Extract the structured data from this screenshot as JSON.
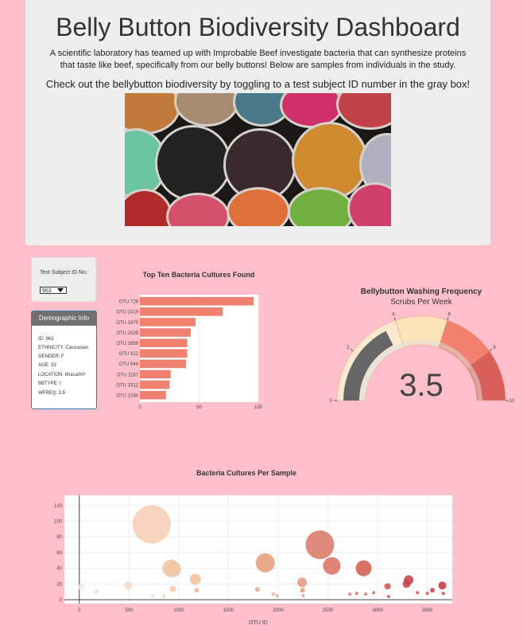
{
  "header": {
    "title": "Belly Button Biodiversity Dashboard",
    "intro": "A scientific laboratory has teamed up with Improbable Beef investigate bacteria that can synthesize proteins that taste like beef, specifically from our belly buttons! Below are samples from individuals in the study.",
    "cta": "Check out the bellybutton biodiversity by toggling to a test subject ID number in the gray box!"
  },
  "selector": {
    "label": "Test Subject ID No.:",
    "value": "963"
  },
  "demographics": {
    "heading": "Demographic Info",
    "rows": [
      "ID: 963",
      "ETHNICITY: Caucasian",
      "GENDER: F",
      "AGE: 33",
      "LOCATION: Ithaca/NY",
      "BBTYPE: I",
      "WFREQ: 3.5"
    ]
  },
  "colors": {
    "bar": "#f0806f",
    "background": "#ffc0cb",
    "gauge_needle": "#666666"
  },
  "chart_data": [
    {
      "type": "bar",
      "orientation": "horizontal",
      "title": "Top Ten Bacteria Cultures Found",
      "categories": [
        "OTU 728",
        "OTU 2419",
        "OTU 1870",
        "OTU 2539",
        "OTU 2859",
        "OTU 922",
        "OTU 944",
        "OTU 1167",
        "OTU 3312",
        "OTU 2244"
      ],
      "values": [
        96,
        70,
        47,
        43,
        40,
        40,
        39,
        26,
        25,
        22
      ],
      "xlim": [
        0,
        100
      ],
      "xticks": [
        "0",
        "50",
        "100"
      ]
    },
    {
      "type": "gauge",
      "title": "Bellybutton Washing Frequency",
      "subtitle": "Scrubs Per Week",
      "value": 3.5,
      "value_label": "3.5",
      "range": [
        0,
        10
      ],
      "ticks": [
        "0",
        "2",
        "4",
        "6",
        "8",
        "10"
      ],
      "bands": [
        {
          "from": 0,
          "to": 4,
          "color": "#fbe9cf"
        },
        {
          "from": 4,
          "to": 6,
          "color": "#fde4b8"
        },
        {
          "from": 6,
          "to": 8,
          "color": "#f2806f"
        },
        {
          "from": 8,
          "to": 10,
          "color": "#d9605a"
        }
      ]
    },
    {
      "type": "scatter",
      "title": "Bacteria Cultures Per Sample",
      "xlabel": "OTU ID",
      "xlim": [
        -150,
        3750
      ],
      "ylim": [
        -5,
        133
      ],
      "xticks": [
        0,
        500,
        1000,
        1500,
        2000,
        2500,
        3000,
        3500
      ],
      "yticks": [
        0,
        20,
        40,
        60,
        80,
        100,
        120
      ],
      "points": [
        {
          "x": 20,
          "y": 16,
          "size": 4,
          "color": "#f0e8e4"
        },
        {
          "x": 170,
          "y": 10,
          "size": 3,
          "color": "#f1e4dc"
        },
        {
          "x": 490,
          "y": 18,
          "size": 5,
          "color": "#f3dcc8"
        },
        {
          "x": 728,
          "y": 96,
          "size": 24,
          "color": "#f5cdb2"
        },
        {
          "x": 740,
          "y": 5,
          "size": 2,
          "color": "#f4d8c4"
        },
        {
          "x": 850,
          "y": 4,
          "size": 2,
          "color": "#f4cfb3"
        },
        {
          "x": 922,
          "y": 40,
          "size": 11,
          "color": "#f0c49f"
        },
        {
          "x": 944,
          "y": 39,
          "size": 10,
          "color": "#f0c7a3"
        },
        {
          "x": 940,
          "y": 14,
          "size": 4,
          "color": "#f2c9aa"
        },
        {
          "x": 1167,
          "y": 26,
          "size": 7,
          "color": "#f2bf9a"
        },
        {
          "x": 1180,
          "y": 12,
          "size": 3,
          "color": "#efb893"
        },
        {
          "x": 1790,
          "y": 13,
          "size": 3,
          "color": "#eaa488"
        },
        {
          "x": 1870,
          "y": 47,
          "size": 12,
          "color": "#e69a76"
        },
        {
          "x": 1950,
          "y": 7,
          "size": 2,
          "color": "#e9a690"
        },
        {
          "x": 1990,
          "y": 5,
          "size": 2,
          "color": "#e9a690"
        },
        {
          "x": 2240,
          "y": 22,
          "size": 6,
          "color": "#e6957e"
        },
        {
          "x": 2244,
          "y": 12,
          "size": 3,
          "color": "#e6957e"
        },
        {
          "x": 2250,
          "y": 5,
          "size": 2,
          "color": "#e79d88"
        },
        {
          "x": 2419,
          "y": 70,
          "size": 18,
          "color": "#da7565"
        },
        {
          "x": 2539,
          "y": 43,
          "size": 11,
          "color": "#d86d5e"
        },
        {
          "x": 2720,
          "y": 7,
          "size": 2,
          "color": "#d9725f"
        },
        {
          "x": 2790,
          "y": 8,
          "size": 2,
          "color": "#d56c5c"
        },
        {
          "x": 2859,
          "y": 40,
          "size": 10,
          "color": "#d1594e"
        },
        {
          "x": 2880,
          "y": 7,
          "size": 2,
          "color": "#d66a5e"
        },
        {
          "x": 2960,
          "y": 9,
          "size": 2,
          "color": "#d56864"
        },
        {
          "x": 3100,
          "y": 17,
          "size": 4,
          "color": "#cf4f4c"
        },
        {
          "x": 3110,
          "y": 4,
          "size": 2,
          "color": "#d05c56"
        },
        {
          "x": 3290,
          "y": 20,
          "size": 5,
          "color": "#c9404a"
        },
        {
          "x": 3312,
          "y": 25,
          "size": 6,
          "color": "#c93b45"
        },
        {
          "x": 3400,
          "y": 9,
          "size": 2,
          "color": "#cc4d51"
        },
        {
          "x": 3500,
          "y": 8,
          "size": 2,
          "color": "#cc4d51"
        },
        {
          "x": 3550,
          "y": 12,
          "size": 3,
          "color": "#c8404a"
        },
        {
          "x": 3650,
          "y": 18,
          "size": 5,
          "color": "#c23742"
        },
        {
          "x": 3660,
          "y": 8,
          "size": 2,
          "color": "#c8404a"
        }
      ]
    }
  ]
}
